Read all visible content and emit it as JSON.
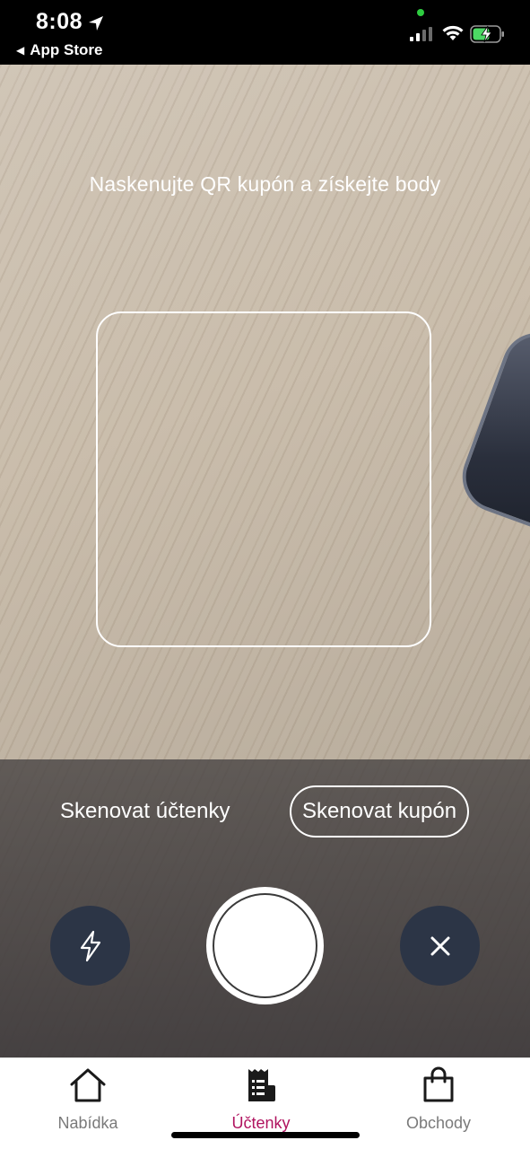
{
  "status_bar": {
    "time": "8:08",
    "back_label": "App Store"
  },
  "camera": {
    "hint": "Naskenujte QR kupón a získejte body"
  },
  "controls": {
    "mode_receipts": "Skenovat účtenky",
    "mode_coupon": "Skenovat kupón",
    "selected_mode": "Skenovat kupón"
  },
  "tabs": [
    {
      "label": "Nabídka",
      "icon": "home-icon",
      "active": false
    },
    {
      "label": "Účtenky",
      "icon": "receipt-icon",
      "active": true
    },
    {
      "label": "Obchody",
      "icon": "shopping-bag-icon",
      "active": false
    }
  ],
  "colors": {
    "accent": "#b0135f",
    "tab_inactive": "#7a7a7a",
    "control_button_bg": "#2c3546",
    "battery_green": "#4cd964"
  }
}
